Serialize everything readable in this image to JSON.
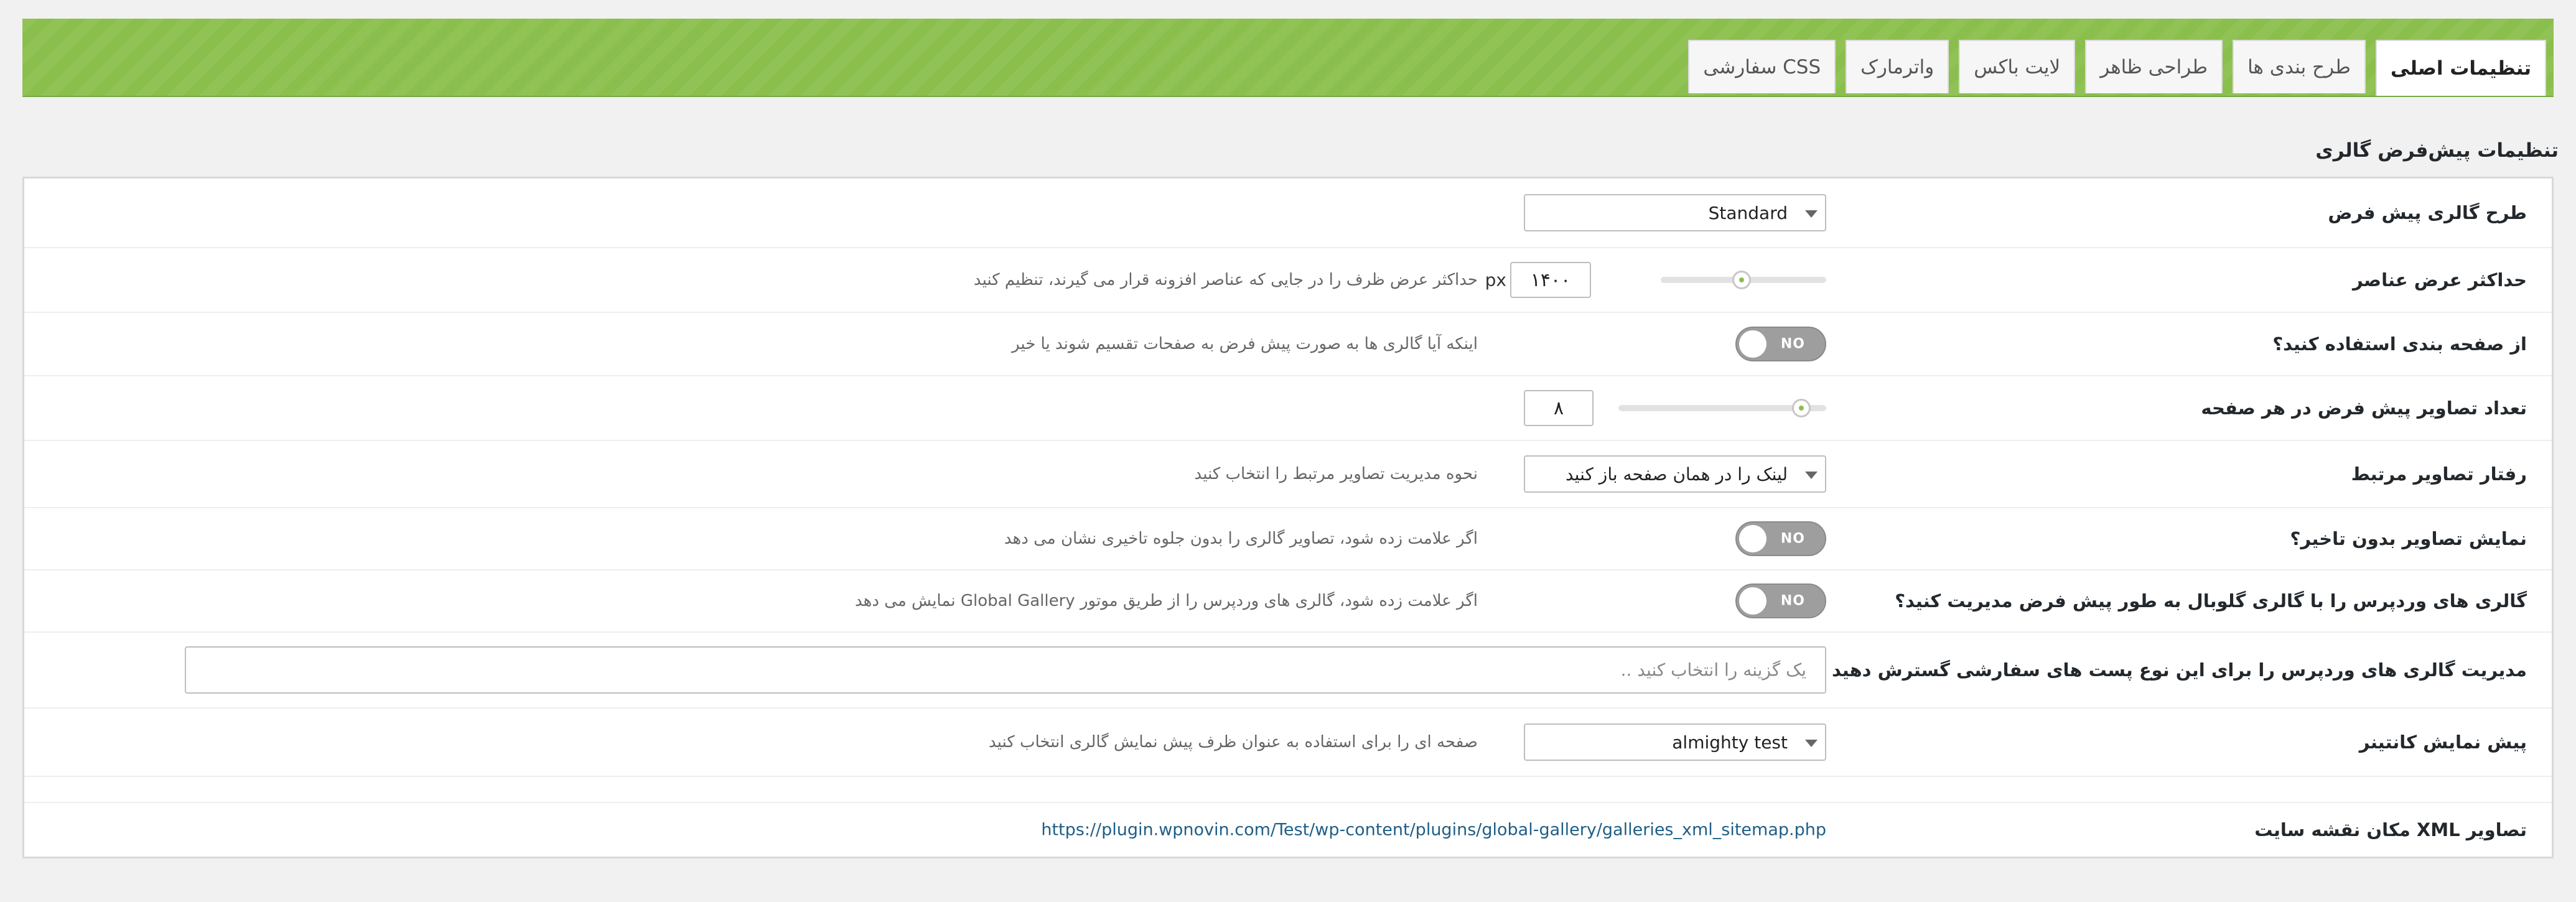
{
  "tabs": [
    {
      "label": "تنظیمات اصلی",
      "active": true
    },
    {
      "label": "طرح بندی ها",
      "active": false
    },
    {
      "label": "طراحی ظاهر",
      "active": false
    },
    {
      "label": "لایت باکس",
      "active": false
    },
    {
      "label": "واترمارک",
      "active": false
    },
    {
      "label": "CSS سفارشی",
      "active": false
    }
  ],
  "section_title": "تنظیمات پیش‌فرض گالری",
  "rows": {
    "layout": {
      "label": "طرح گالری پیش فرض",
      "value": "Standard"
    },
    "max_width": {
      "label": "حداکثر عرض عناصر",
      "value": "۱۴۰۰",
      "unit": "px",
      "desc": "حداکثر عرض ظرف را در جایی که عناصر افزونه قرار می گیرند، تنظیم کنید"
    },
    "pagination": {
      "label": "از صفحه بندی استفاده کنید؟",
      "toggle": "NO",
      "desc": "اینکه آیا گالری ها به صورت پیش فرض به صفحات تقسیم شوند یا خیر"
    },
    "per_page": {
      "label": "تعداد تصاویر پیش فرض در هر صفحه",
      "value": "۸"
    },
    "linked_behavior": {
      "label": "رفتار تصاویر مرتبط",
      "value": "لینک را در همان صفحه باز کنید",
      "desc": "نحوه مدیریت تصاویر مرتبط را انتخاب کنید"
    },
    "no_delay": {
      "label": "نمایش تصاویر بدون تاخیر؟",
      "toggle": "NO",
      "desc": "اگر علامت زده شود، تصاویر گالری را بدون جلوه تاخیری نشان می دهد"
    },
    "wp_galleries": {
      "label": "گالری های وردپرس را با گالری گلوبال به طور پیش فرض مدیریت کنید؟",
      "toggle": "NO",
      "desc": "اگر علامت زده شود، گالری های وردپرس را از طریق موتور Global Gallery نمایش می دهد"
    },
    "post_types": {
      "label": "مدیریت گالری های وردپرس را برای این نوع پست های سفارشی گسترش دهید",
      "placeholder": "یک گزینه را انتخاب کنید .."
    },
    "preview_container": {
      "label": "پیش نمایش کانتینر",
      "value": "almighty test",
      "desc": "صفحه ای را برای استفاده به عنوان ظرف پیش نمایش گالری انتخاب کنید"
    },
    "sitemap": {
      "label": "تصاویر XML مکان نقشه سایت",
      "url": "https://plugin.wpnovin.com/Test/wp-content/plugins/global-gallery/galleries_xml_sitemap.php"
    }
  },
  "colors": {
    "accent": "#8bbf4d",
    "link": "#1f5e86",
    "toggle_off": "#9e9e9e"
  }
}
